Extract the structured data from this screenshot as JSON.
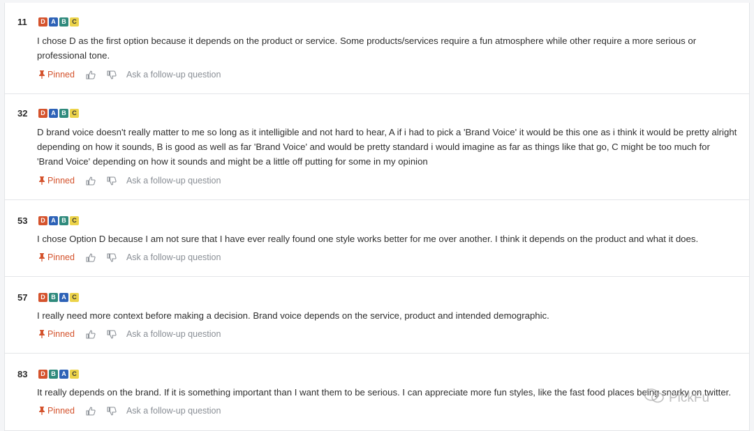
{
  "colors": {
    "D": "#d4532d",
    "A": "#2d62b7",
    "B": "#2f8a7c",
    "C": "#ecd34a",
    "pinned": "#d4532d"
  },
  "actions": {
    "pinned_label": "Pinned",
    "follow_up_label": "Ask a follow-up question",
    "like_icon": "thumbs-up-icon",
    "dislike_icon": "thumbs-down-icon",
    "pin_icon": "pin-icon"
  },
  "responses": [
    {
      "number": "11",
      "ranking": [
        "D",
        "A",
        "B",
        "C"
      ],
      "text": "I chose D as the first option because it depends on the product or service. Some products/services require a fun atmosphere while other require a more serious or professional tone."
    },
    {
      "number": "32",
      "ranking": [
        "D",
        "A",
        "B",
        "C"
      ],
      "text": "D brand voice doesn't really matter to me so long as it intelligible and not hard to hear, A if i had to pick a 'Brand Voice' it would be this one as i think it would be pretty alright depending on how it sounds, B is good as well as far 'Brand Voice' and would be pretty standard i would imagine as far as things like that go, C might be too much for 'Brand Voice' depending on how it sounds and might be a little off putting for some in my opinion"
    },
    {
      "number": "53",
      "ranking": [
        "D",
        "A",
        "B",
        "C"
      ],
      "text": "I chose Option D because I am not sure that I have ever really found one style works better for me over another. I think it depends on the product and what it does."
    },
    {
      "number": "57",
      "ranking": [
        "D",
        "B",
        "A",
        "C"
      ],
      "text": "I really need more context before making a decision. Brand voice depends on the service, product and intended demographic."
    },
    {
      "number": "83",
      "ranking": [
        "D",
        "B",
        "A",
        "C"
      ],
      "text": "It really depends on the brand. If it is something important than I want them to be serious. I can appreciate more fun styles, like the fast food places being snarky on twitter."
    }
  ],
  "watermark": {
    "text": "PickFu",
    "icon": "chat-bubble-icon"
  }
}
